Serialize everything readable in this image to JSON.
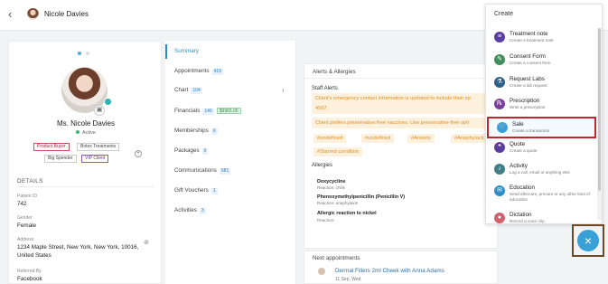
{
  "header": {
    "back_icon": "chevron-left-icon",
    "client_name": "Nicole Davies"
  },
  "profile": {
    "name": "Ms. Nicole Davies",
    "status": "Active",
    "tags": [
      "Product Buyer",
      "Botox Treatments",
      "Big Spender",
      "VIP Client"
    ],
    "details_title": "DETAILS",
    "fields": [
      {
        "label": "Patient ID",
        "value": "742"
      },
      {
        "label": "Gender",
        "value": "Female"
      },
      {
        "label": "Address",
        "value": "1234 Maple Street, New York, New York, 10016, United States"
      },
      {
        "label": "Referred By",
        "value": "Facebook"
      }
    ]
  },
  "nav": {
    "items": [
      {
        "label": "Summary",
        "badge": ""
      },
      {
        "label": "Appointments",
        "badge": "419"
      },
      {
        "label": "Chart",
        "badge": "104"
      },
      {
        "label": "Financials",
        "badge": "149",
        "extra": "$9965.00"
      },
      {
        "label": "Memberships",
        "badge": "0"
      },
      {
        "label": "Packages",
        "badge": "0"
      },
      {
        "label": "Communications",
        "badge": "581"
      },
      {
        "label": "Gift Vouchers",
        "badge": "1"
      },
      {
        "label": "Activities",
        "badge": "3"
      }
    ]
  },
  "alerts": {
    "title": "Alerts & Allergies",
    "staff_title": "Staff Alerts",
    "staff_alerts": [
      "Client's emergency contact information is updated to include their sp",
      "4567.",
      "Client prefers preservative-free vaccines. Use preservative-free opti"
    ],
    "hashtags": [
      "#undefined",
      "#undefined",
      "#Anxiety",
      "#Anaphylacti",
      "#Starred condition"
    ],
    "allergies_title": "Allergies",
    "allergies": [
      {
        "name": "Doxycycline",
        "reaction": "Reaction: chills"
      },
      {
        "name": "Phenoxymethylpenicillin (Penicillin V)",
        "reaction": "Reaction: anaphylaxis"
      },
      {
        "name": "Allergic reaction to nickel",
        "reaction": "Reaction:"
      }
    ]
  },
  "next_appointments": {
    "title": "Next appointments",
    "item_title": "Dermal Fillers 2ml Cheek with Anna Adams",
    "item_date": "11 Sep, Wed"
  },
  "create_menu": {
    "title": "Create",
    "items": [
      {
        "label": "Treatment note",
        "desc": "Create a treatment note",
        "icon": "note-icon",
        "color": "#5a3fa0"
      },
      {
        "label": "Consent Form",
        "desc": "Create a consent form",
        "icon": "pen-icon",
        "color": "#3f8f5a"
      },
      {
        "label": "Request Labs",
        "desc": "Create a lab request",
        "icon": "flask-icon",
        "color": "#2f5f8a"
      },
      {
        "label": "Prescription",
        "desc": "Write a prescription",
        "icon": "rx-icon",
        "color": "#7a3f9a"
      },
      {
        "label": "Sale",
        "desc": "Create a transaction",
        "icon": "cart-icon",
        "color": "#3aa0d8"
      },
      {
        "label": "Quote",
        "desc": "Create a quote",
        "icon": "quote-icon",
        "color": "#5a3fa0"
      },
      {
        "label": "Activity",
        "desc": "Log a call, email or anything else",
        "icon": "activity-icon",
        "color": "#3f7f8a"
      },
      {
        "label": "Education",
        "desc": "Send aftercare, precare or any other kind of education",
        "icon": "education-icon",
        "color": "#2f8fc8"
      },
      {
        "label": "Dictation",
        "desc": "Record a voice clip",
        "icon": "mic-icon",
        "color": "#d06070"
      }
    ]
  },
  "fab": {
    "icon": "close-icon",
    "glyph": "×"
  }
}
